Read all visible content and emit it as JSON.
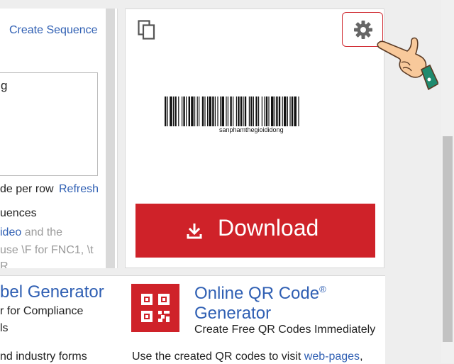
{
  "left": {
    "create_sequence": "Create Sequence",
    "text_value": "g",
    "per_row": "de per row",
    "refresh": "Refresh",
    "sequences": "uences",
    "video_link": "ideo",
    "video_rest": " and the",
    "use_line": "use \\F for FNC1, \\t",
    "r_line": "R"
  },
  "barcode": {
    "caption": "sanphamthegioididong"
  },
  "download": {
    "label": "Download"
  },
  "bottom": {
    "left_title": "bel Generator",
    "left_sub1": "r for Compliance",
    "left_sub2": "ls",
    "left_sub3": "nd industry forms",
    "qr_title_line1": "Online QR Code",
    "qr_title_sup": "®",
    "qr_title_line2": "Generator",
    "qr_sub": "Create Free QR Codes Immediately",
    "qr_use_prefix": "Use the created QR codes to visit ",
    "qr_use_link": "web-pages",
    "qr_use_suffix": ","
  },
  "icons": {
    "copy": "copy-icon",
    "settings": "gear-icon",
    "download": "download-arrow-icon",
    "pointer": "pointing-hand-icon",
    "qr": "qr-code-icon"
  },
  "colors": {
    "accent_red": "#cf2229",
    "link_blue": "#2f5fb3"
  }
}
